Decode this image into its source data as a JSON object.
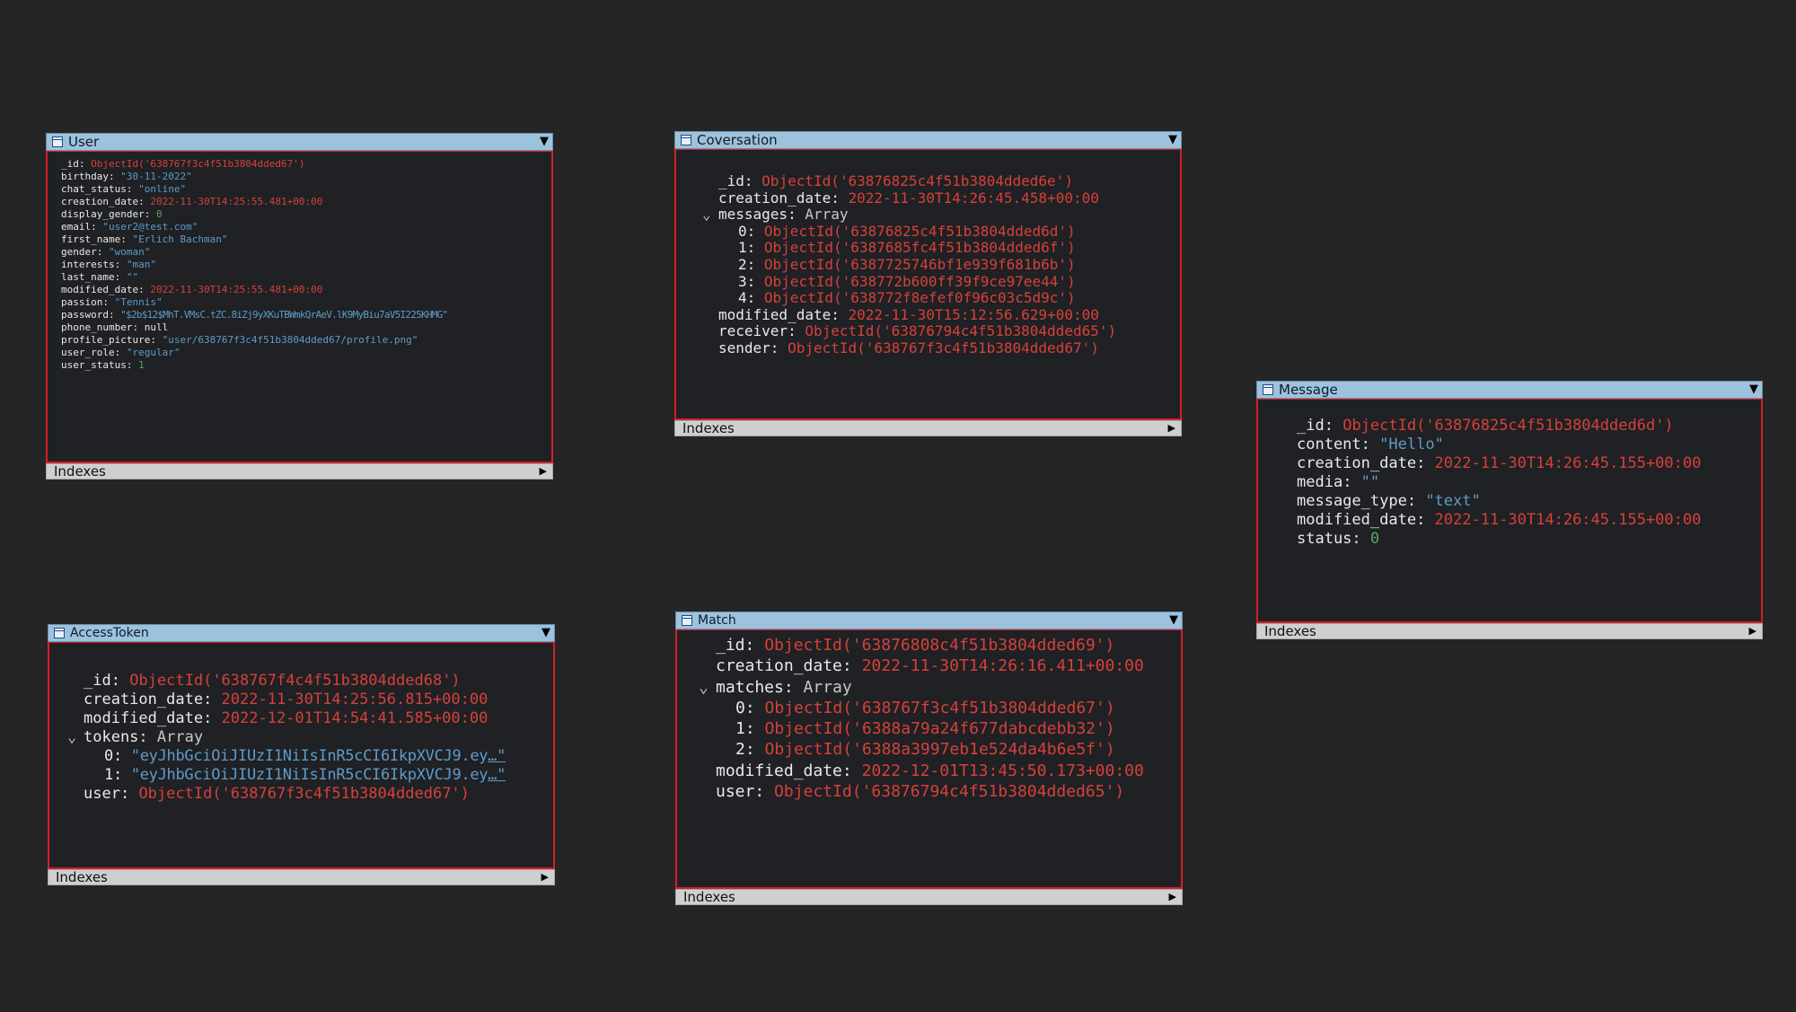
{
  "footer_label": "Indexes",
  "user": {
    "title": "User",
    "fields": [
      {
        "key": "_id",
        "value": "ObjectId('638767f3c4f51b3804dded67')"
      },
      {
        "key": "birthday",
        "value": "\"30-11-2022\""
      },
      {
        "key": "chat_status",
        "value": "\"online\""
      },
      {
        "key": "creation_date",
        "value": "2022-11-30T14:25:55.481+00:00"
      },
      {
        "key": "display_gender",
        "value": "0"
      },
      {
        "key": "email",
        "value": "\"user2@test.com\""
      },
      {
        "key": "first_name",
        "value": "\"Erlich Bachman\""
      },
      {
        "key": "gender",
        "value": "\"woman\""
      },
      {
        "key": "interests",
        "value": "\"man\""
      },
      {
        "key": "last_name",
        "value": "\"\""
      },
      {
        "key": "modified_date",
        "value": "2022-11-30T14:25:55.481+00:00"
      },
      {
        "key": "passion",
        "value": "\"Tennis\""
      },
      {
        "key": "password",
        "value": "\"$2b$12$MhT.VMsC.tZC.8iZj9yXKuTBWmkQrAeV.lK9MyBiu7aV5I225KHMG\""
      },
      {
        "key": "phone_number",
        "value": "null"
      },
      {
        "key": "profile_picture",
        "value": "\"user/638767f3c4f51b3804dded67/profile.png\""
      },
      {
        "key": "user_role",
        "value": "\"regular\""
      },
      {
        "key": "user_status",
        "value": "1"
      }
    ]
  },
  "conversation": {
    "title": "Coversation",
    "id": {
      "key": "_id",
      "value": "ObjectId('63876825c4f51b3804dded6e')"
    },
    "creation_date": {
      "key": "creation_date",
      "value": "2022-11-30T14:26:45.458+00:00"
    },
    "messages": {
      "key": "messages",
      "type": "Array",
      "items": [
        {
          "index": "0",
          "value": "ObjectId('63876825c4f51b3804dded6d')"
        },
        {
          "index": "1",
          "value": "ObjectId('6387685fc4f51b3804dded6f')"
        },
        {
          "index": "2",
          "value": "ObjectId('6387725746bf1e939f681b6b')"
        },
        {
          "index": "3",
          "value": "ObjectId('638772b600ff39f9ce97ee44')"
        },
        {
          "index": "4",
          "value": "ObjectId('638772f8efef0f96c03c5d9c')"
        }
      ]
    },
    "modified_date": {
      "key": "modified_date",
      "value": "2022-11-30T15:12:56.629+00:00"
    },
    "receiver": {
      "key": "receiver",
      "value": "ObjectId('63876794c4f51b3804dded65')"
    },
    "sender": {
      "key": "sender",
      "value": "ObjectId('638767f3c4f51b3804dded67')"
    }
  },
  "message": {
    "title": "Message",
    "fields": [
      {
        "key": "_id",
        "value": "ObjectId('63876825c4f51b3804dded6d')"
      },
      {
        "key": "content",
        "value": "\"Hello\""
      },
      {
        "key": "creation_date",
        "value": "2022-11-30T14:26:45.155+00:00"
      },
      {
        "key": "media",
        "value": "\"\""
      },
      {
        "key": "message_type",
        "value": "\"text\""
      },
      {
        "key": "modified_date",
        "value": "2022-11-30T14:26:45.155+00:00"
      },
      {
        "key": "status",
        "value": "0"
      }
    ]
  },
  "access_token": {
    "title": "AccessToken",
    "id": {
      "key": "_id",
      "value": "ObjectId('638767f4c4f51b3804dded68')"
    },
    "creation_date": {
      "key": "creation_date",
      "value": "2022-11-30T14:25:56.815+00:00"
    },
    "modified_date": {
      "key": "modified_date",
      "value": "2022-12-01T14:54:41.585+00:00"
    },
    "tokens": {
      "key": "tokens",
      "type": "Array",
      "items": [
        {
          "index": "0",
          "value": "\"eyJhbGciOiJIUzI1NiIsInR5cCI6IkpXVCJ9.ey",
          "more": "…\""
        },
        {
          "index": "1",
          "value": "\"eyJhbGciOiJIUzI1NiIsInR5cCI6IkpXVCJ9.ey",
          "more": "…\""
        }
      ]
    },
    "user": {
      "key": "user",
      "value": "ObjectId('638767f3c4f51b3804dded67')"
    }
  },
  "match": {
    "title": "Match",
    "id": {
      "key": "_id",
      "value": "ObjectId('63876808c4f51b3804dded69')"
    },
    "creation_date": {
      "key": "creation_date",
      "value": "2022-11-30T14:26:16.411+00:00"
    },
    "matches": {
      "key": "matches",
      "type": "Array",
      "items": [
        {
          "index": "0",
          "value": "ObjectId('638767f3c4f51b3804dded67')"
        },
        {
          "index": "1",
          "value": "ObjectId('6388a79a24f677dabcdebb32')"
        },
        {
          "index": "2",
          "value": "ObjectId('6388a3997eb1e524da4b6e5f')"
        }
      ]
    },
    "modified_date": {
      "key": "modified_date",
      "value": "2022-12-01T13:45:50.173+00:00"
    },
    "user": {
      "key": "user",
      "value": "ObjectId('63876794c4f51b3804dded65')"
    }
  }
}
